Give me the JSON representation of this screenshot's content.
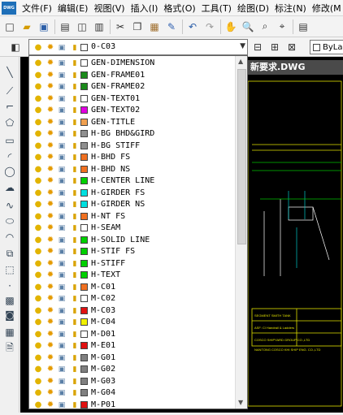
{
  "titlebar": {
    "logo_text": "DWG",
    "menus": [
      "文件(F)",
      "编辑(E)",
      "视图(V)",
      "插入(I)",
      "格式(O)",
      "工具(T)",
      "绘图(D)",
      "标注(N)",
      "修改(M"
    ]
  },
  "toolbar": {
    "icons": [
      "new-icon",
      "open-icon",
      "save-icon",
      "print-icon",
      "preview-icon",
      "publish-icon",
      "cut-icon",
      "copy-icon",
      "paste-icon",
      "match-properties-icon",
      "undo-icon",
      "redo-icon",
      "pan-icon",
      "zoom-realtime-icon",
      "zoom-window-icon",
      "zoom-previous-icon",
      "properties-icon"
    ]
  },
  "layer_combo": {
    "current": "0-C03",
    "current_color": "#ffffff"
  },
  "linetype_combo": {
    "value": "ByLa"
  },
  "document_tab": {
    "title": "新要求.DWG"
  },
  "layers": [
    {
      "name": "GEN-DIMENSION",
      "color": "#ffffff"
    },
    {
      "name": "GEN-FRAME01",
      "color": "#1a8a1a"
    },
    {
      "name": "GEN-FRAME02",
      "color": "#1a8a1a"
    },
    {
      "name": "GEN-TEXT01",
      "color": "#ffffff"
    },
    {
      "name": "GEN-TEXT02",
      "color": "#e000e0"
    },
    {
      "name": "GEN-TITLE",
      "color": "#f0a050"
    },
    {
      "name": "H-BG BHD&GIRD",
      "color": "#909090"
    },
    {
      "name": "H-BG STIFF",
      "color": "#909090"
    },
    {
      "name": "H-BHD FS",
      "color": "#f07020"
    },
    {
      "name": "H-BHD NS",
      "color": "#f07020"
    },
    {
      "name": "H-CENTER LINE",
      "color": "#00d000"
    },
    {
      "name": "H-GIRDER FS",
      "color": "#00e0e0"
    },
    {
      "name": "H-GIRDER NS",
      "color": "#00e0e0"
    },
    {
      "name": "H-NT FS",
      "color": "#f07020"
    },
    {
      "name": "H-SEAM",
      "color": "#ffffff"
    },
    {
      "name": "H-SOLID LINE",
      "color": "#00d000"
    },
    {
      "name": "H-STIF FS",
      "color": "#00d000"
    },
    {
      "name": "H-STIFF",
      "color": "#00d000"
    },
    {
      "name": "H-TEXT",
      "color": "#00d000"
    },
    {
      "name": "M-C01",
      "color": "#f07020"
    },
    {
      "name": "M-C02",
      "color": "#ffffff"
    },
    {
      "name": "M-C03",
      "color": "#e01010"
    },
    {
      "name": "M-C04",
      "color": "#f0f000"
    },
    {
      "name": "M-D01",
      "color": "#ffffff"
    },
    {
      "name": "M-E01",
      "color": "#e01010"
    },
    {
      "name": "M-G01",
      "color": "#808080"
    },
    {
      "name": "M-G02",
      "color": "#808080"
    },
    {
      "name": "M-G03",
      "color": "#808080"
    },
    {
      "name": "M-G04",
      "color": "#808080"
    },
    {
      "name": "M-P01",
      "color": "#e01010"
    }
  ],
  "drawing_text": {
    "line1": "SEGMENT SMITH TANK",
    "line2": "ASF: Cl  Handrail & Ladders",
    "line3": "COSCO SHIPYARD GROUP CO.,LTD",
    "line4": "NANTONG COSCO KHI SHIP ENG. CO.,LTD"
  }
}
